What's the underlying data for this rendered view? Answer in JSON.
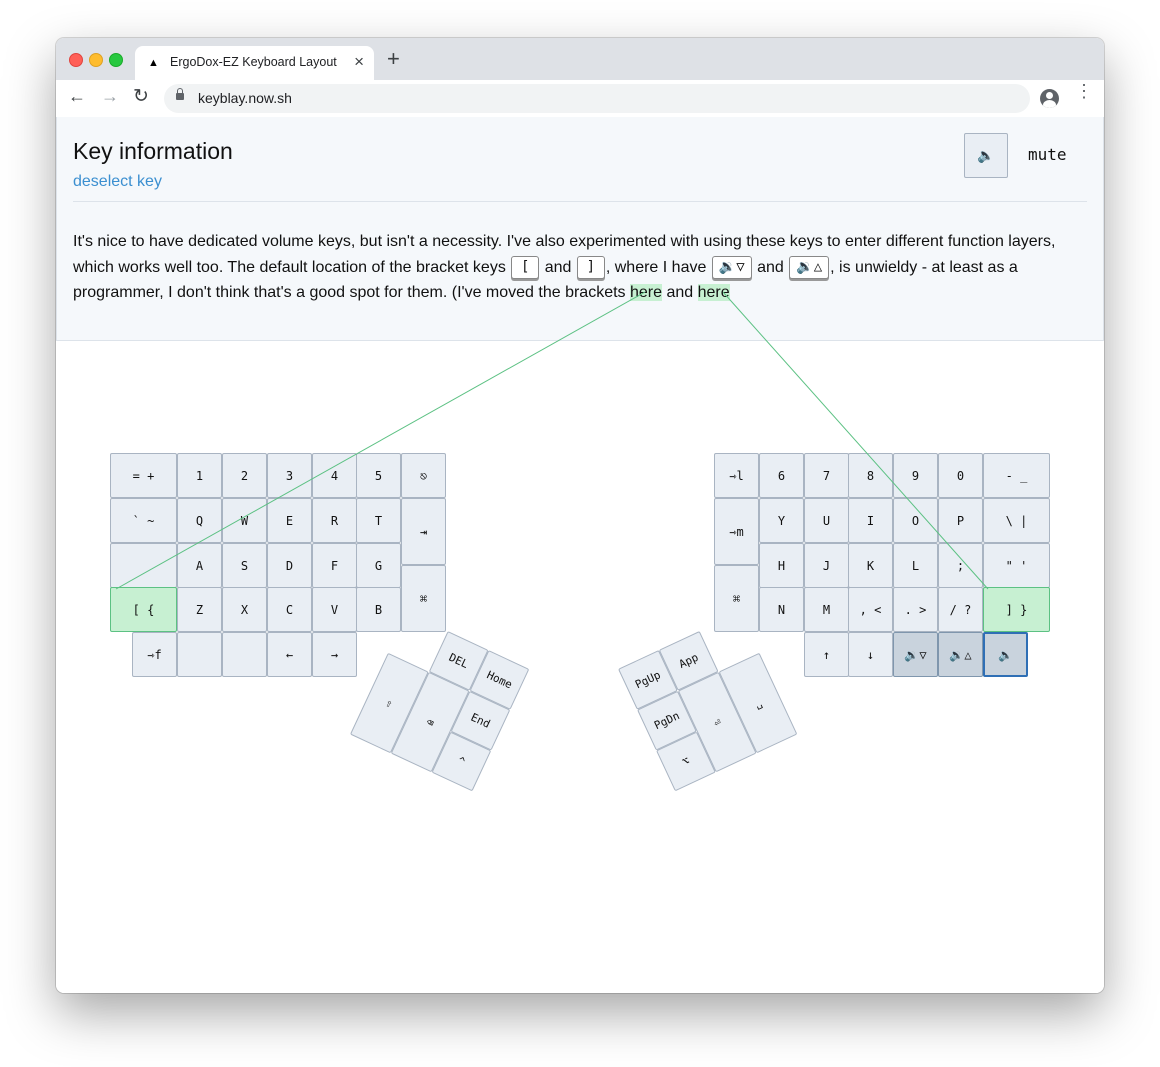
{
  "browser": {
    "tab_title": "ErgoDox-EZ Keyboard Layout",
    "tab_favicon": "▲",
    "tab_close": "×",
    "new_tab": "+",
    "url": "keyblay.now.sh",
    "back": "←",
    "forward": "→",
    "reload": "↻",
    "star": "☆",
    "menu": "⋮"
  },
  "info": {
    "title": "Key information",
    "deselect": "deselect key",
    "selected_key_glyph": "🔈",
    "selected_key_label": "mute",
    "desc": {
      "p1": "It's nice to have dedicated volume keys, but isn't a necessity. I've also experimented with using these keys to enter different function layers, which works well too. The default location of the bracket keys ",
      "k1": "[",
      "p2": " and ",
      "k2": "]",
      "p3": ", where I have ",
      "k3": "🔉▽",
      "p4": " and ",
      "k4": "🔉△",
      "p5": ", is unwieldy - at least as a programmer, I don't think that's a good spot for them. (I've moved the brackets ",
      "link1": "here",
      "p6": " and ",
      "link2": "here"
    }
  },
  "keyboard": {
    "left": [
      [
        "= +",
        "1",
        "2",
        "3",
        "4",
        "5",
        "⎋"
      ],
      [
        "` ~",
        "Q",
        "W",
        "E",
        "R",
        "T",
        "⇥"
      ],
      [
        "",
        "A",
        "S",
        "D",
        "F",
        "G"
      ],
      [
        "[ {",
        "Z",
        "X",
        "C",
        "V",
        "B",
        "⌘"
      ],
      [
        "⇾f",
        "",
        "",
        "←",
        "→"
      ]
    ],
    "right": [
      [
        "⇾l",
        "6",
        "7",
        "8",
        "9",
        "0",
        "- _"
      ],
      [
        "⇾m",
        "Y",
        "U",
        "I",
        "O",
        "P",
        "\\ |"
      ],
      [
        "H",
        "J",
        "K",
        "L",
        ";",
        "\" '"
      ],
      [
        "⌘",
        "N",
        "M",
        ", <",
        ". >",
        "/ ?",
        "] }"
      ],
      [
        "↑",
        "↓",
        "🔉▽",
        "🔉△",
        "🔈"
      ]
    ],
    "left_thumb": [
      "DEL",
      "Home",
      "End",
      "⇧",
      "⌫",
      "^"
    ],
    "right_thumb": [
      "App",
      "PgUp",
      "PgDn",
      "⏎",
      "␣",
      "⌥"
    ]
  },
  "colors": {
    "highlight": "#c7f0d2",
    "key": "#e9eef4",
    "selected_border": "#2f6fb5",
    "link": "#3b8fd0",
    "connector": "#5cc183"
  }
}
